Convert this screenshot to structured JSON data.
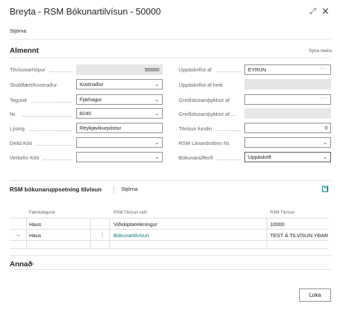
{
  "window": {
    "title": "Breyta - RSM Bókunartilvísun - 50000",
    "expand_icon": "⤢",
    "close_icon": "✕"
  },
  "actions": {
    "manage": "Stjórna"
  },
  "general": {
    "title": "Almennt",
    "show_more": "Sýna meira",
    "left_fields": [
      {
        "label": "Tilvísunarhópur",
        "value": "50000",
        "type": "readonly-number"
      },
      {
        "label": "Skuldfært/Kostnaður",
        "value": "Kostnaður",
        "type": "select"
      },
      {
        "label": "Tegund",
        "value": "Fjárhagur",
        "type": "select"
      },
      {
        "label": "Nr.",
        "value": "8240",
        "type": "select"
      },
      {
        "label": "Lýsing",
        "value": "Reykjavíkurpóstur",
        "type": "text"
      },
      {
        "label": "Deild Kóti",
        "value": "",
        "type": "select"
      },
      {
        "label": "Verkefni Kóti",
        "value": "",
        "type": "select"
      }
    ],
    "right_fields": [
      {
        "label": "Uppáskrifist af",
        "value": "EYRUN",
        "type": "lookup"
      },
      {
        "label": "Uppáskrifist af heiti",
        "value": "",
        "type": "readonly"
      },
      {
        "label": "Greiðslusamþykkist af",
        "value": "",
        "type": "lookup"
      },
      {
        "label": "Greiðslusamþykkist af ...",
        "value": "",
        "type": "readonly"
      },
      {
        "label": "Tilvísun fundin",
        "value": "0",
        "type": "number"
      },
      {
        "label": "RSM Lánardrottinn Nr.",
        "value": "",
        "type": "select"
      },
      {
        "label": "Bókunaraðferð",
        "value": "Uppáskrift",
        "type": "select-dark"
      }
    ]
  },
  "subpage": {
    "title": "RSM bókunaruppsetning tilvísun",
    "manage": "Stjórna",
    "columns": [
      "Færslutegund",
      "RSM Tilvísun nafn",
      "RSM Tilvísun"
    ],
    "rows": [
      {
        "type": "Haus",
        "name": "Viðskiptareikningur",
        "reference": "10000",
        "selected": false
      },
      {
        "type": "Haus",
        "name": "Bókunartilvísun",
        "reference": "TEST Á TILVÍSUN YÐAR",
        "selected": true
      }
    ],
    "row_arrow_icon": "→",
    "row_menu_icon": "⋮"
  },
  "other": {
    "title": "Annað"
  },
  "footer": {
    "close_label": "Loka"
  }
}
